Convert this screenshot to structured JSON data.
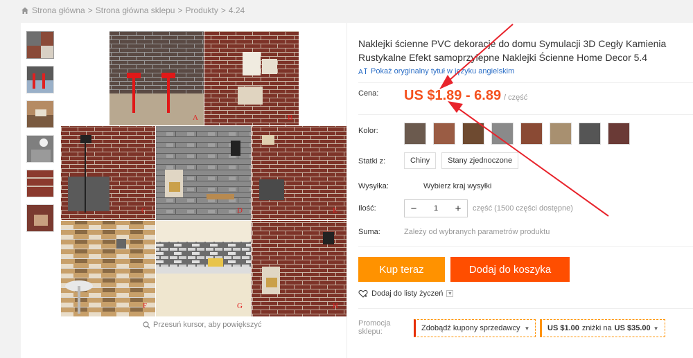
{
  "breadcrumb": {
    "items": [
      "Strona główna",
      "Strona główna sklepu",
      "Produkty",
      "4.24"
    ],
    "separator": ">"
  },
  "gallery": {
    "zoom_hint": "Przesuń kursor, aby powiększyć",
    "thumbnail_count": 6,
    "tile_letters": [
      "A",
      "B",
      "C",
      "D",
      "E",
      "F",
      "G",
      "H"
    ]
  },
  "product": {
    "title": "Naklejki ścienne PVC dekoracje do domu Symulacji 3D Cegły Kamienia Rustykalne Efekt samoprzylepne Naklejki Ścienne Home Decor 5.4",
    "translate_link": "Pokaż oryginalny tytuł w języku angielskim"
  },
  "price": {
    "label": "Cena:",
    "value": "US $1.89 - 6.89",
    "unit": "/ część"
  },
  "color": {
    "label": "Kolor:",
    "swatches": [
      "#6b5a4e",
      "#9a5c44",
      "#6e4a30",
      "#8a8a8a",
      "#8a4a34",
      "#a89070",
      "#555555",
      "#6a3a36",
      "#8b4240"
    ]
  },
  "ships_from": {
    "label": "Statki z:",
    "options": [
      "Chiny",
      "Stany zjednoczone"
    ]
  },
  "shipping": {
    "label": "Wysyłka:",
    "value": "Wybierz kraj wysyłki"
  },
  "quantity": {
    "label": "Ilość:",
    "value": "1",
    "minus": "−",
    "plus": "+",
    "info": "część (1500 części dostępne)"
  },
  "total": {
    "label": "Suma:",
    "value": "Zależy od wybranych parametrów produktu"
  },
  "actions": {
    "buy_now": "Kup teraz",
    "add_to_cart": "Dodaj do koszyka",
    "wishlist": "Dodaj do listy życzeń"
  },
  "promo": {
    "label": "Promocja sklepu:",
    "coupon": "Zdobądź kupony sprzedawcy",
    "discount_amount": "US $1.00",
    "discount_text": "zniżki na",
    "discount_threshold": "US $35.00"
  },
  "colors": {
    "price": "#f4511e",
    "buy_now": "#ff9200",
    "add_to_cart": "#ff4e00",
    "link": "#2b6ec6",
    "annotation_arrow": "#e8242c"
  }
}
